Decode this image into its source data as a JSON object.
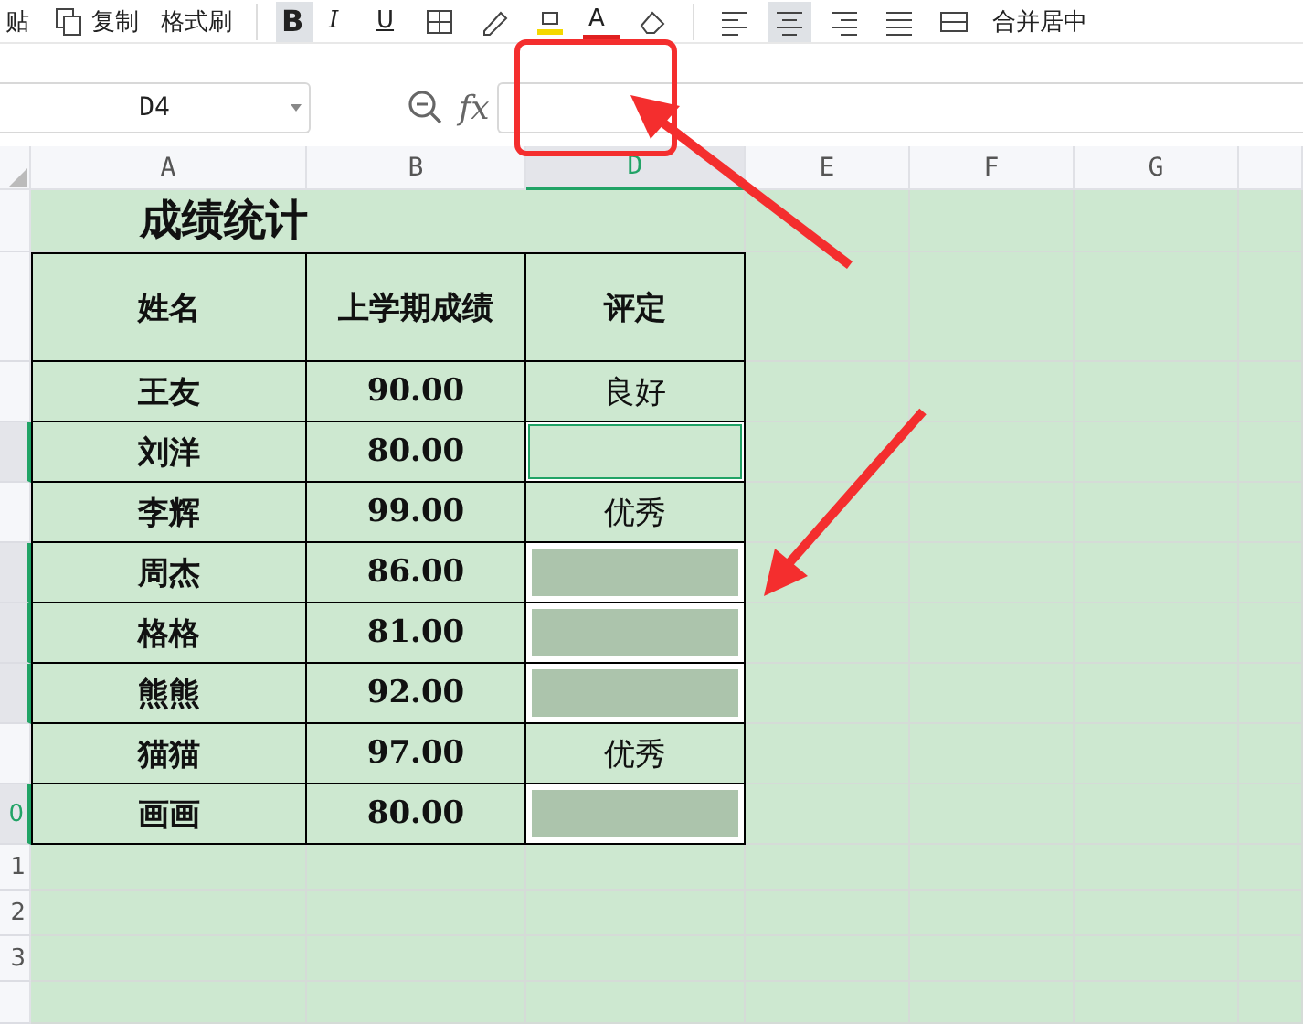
{
  "toolbar": {
    "paste": "贴",
    "copy": "复制",
    "format_painter": "格式刷",
    "bold": {
      "label": "B",
      "selected": true
    },
    "italic": "I",
    "underline": "U",
    "font_color": "A",
    "alignments": [
      {
        "selected": false
      },
      {
        "selected": true
      },
      {
        "selected": false
      },
      {
        "selected": false
      }
    ],
    "merge": "合并居中"
  },
  "formula_bar": {
    "cell": "D4",
    "fx": "fx"
  },
  "columns": [
    {
      "label": "A",
      "selected": false
    },
    {
      "label": "B",
      "selected": false
    },
    {
      "label": "D",
      "selected": true
    },
    {
      "label": "E",
      "selected": false
    },
    {
      "label": "F",
      "selected": false
    },
    {
      "label": "G",
      "selected": false
    }
  ],
  "row_headers": [
    {
      "selected": false
    },
    {
      "selected": false
    },
    {
      "selected": false
    },
    {
      "selected": true
    },
    {
      "selected": false
    },
    {
      "selected": true
    },
    {
      "selected": true
    },
    {
      "selected": true
    },
    {
      "selected": false
    },
    {
      "label": "0",
      "selected": true
    },
    {
      "label": "1",
      "selected": false
    },
    {
      "label": "2",
      "selected": false
    },
    {
      "label": "3",
      "selected": false
    }
  ],
  "sheet": {
    "title": "成绩统计",
    "header": [
      "姓名",
      "上学期成绩",
      "评定"
    ],
    "records": [
      {
        "name": "王友",
        "score": "90.00",
        "rating": "良好",
        "selected": false,
        "active": false
      },
      {
        "name": "刘洋",
        "score": "80.00",
        "selected": true,
        "active": true
      },
      {
        "name": "李辉",
        "score": "99.00",
        "rating": "优秀",
        "selected": false,
        "active": false
      },
      {
        "name": "周杰",
        "score": "86.00",
        "selected": true,
        "active": false
      },
      {
        "name": "格格",
        "score": "81.00",
        "selected": true,
        "active": false
      },
      {
        "name": "熊熊",
        "score": "92.00",
        "selected": true,
        "active": false
      },
      {
        "name": "猫猫",
        "score": "97.00",
        "rating": "优秀",
        "selected": false,
        "active": false
      },
      {
        "name": "画画",
        "score": "80.00",
        "selected": true,
        "active": false
      }
    ]
  }
}
